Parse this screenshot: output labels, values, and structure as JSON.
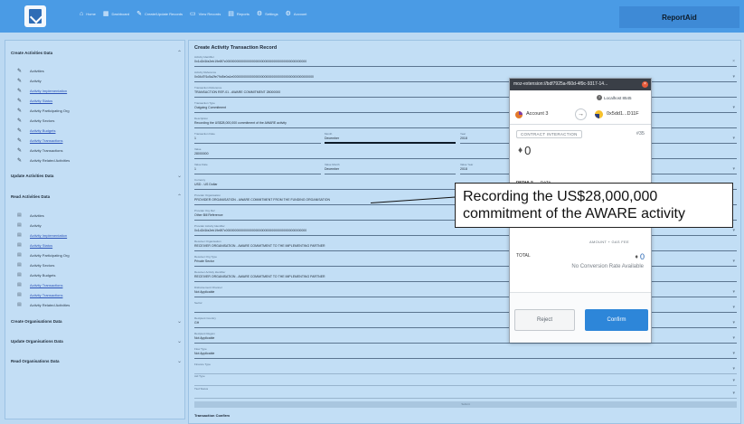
{
  "app": {
    "brand_button": "ReportAid",
    "nav": [
      {
        "icon": "⌂",
        "icon_name": "home-icon",
        "label": "Home"
      },
      {
        "icon": "▦",
        "icon_name": "dashboard-icon",
        "label": "Dashboard"
      },
      {
        "icon": "✎",
        "icon_name": "edit-icon",
        "label": "Create/Update Records"
      },
      {
        "icon": "▭",
        "icon_name": "view-icon",
        "label": "View Records"
      },
      {
        "icon": "▤",
        "icon_name": "reports-icon",
        "label": "Reports"
      },
      {
        "icon": "⚙",
        "icon_name": "gear-icon",
        "label": "Settings"
      },
      {
        "icon": "⚙",
        "icon_name": "account-icon",
        "label": "Account"
      }
    ]
  },
  "sidebar": {
    "create": {
      "title": "Create Activities Data",
      "items": [
        {
          "label": "Activities",
          "link": false
        },
        {
          "label": "Activity",
          "link": false
        },
        {
          "label": "Activity Implementation",
          "link": true
        },
        {
          "label": "Activity Status",
          "link": true
        },
        {
          "label": "Activity Participating Org",
          "link": false
        },
        {
          "label": "Activity Sectors",
          "link": false
        },
        {
          "label": "Activity Budgets",
          "link": true
        },
        {
          "label": "Activity Transactions",
          "link": true
        },
        {
          "label": "Activity Transactions",
          "link": false
        },
        {
          "label": "Activity Related Activities",
          "link": false
        }
      ]
    },
    "update": {
      "title": "Update Activities Data"
    },
    "read": {
      "title": "Read Activities Data",
      "items": [
        {
          "label": "Activities",
          "link": false
        },
        {
          "label": "Activity",
          "link": false
        },
        {
          "label": "Activity Implementation",
          "link": true
        },
        {
          "label": "Activity Status",
          "link": true
        },
        {
          "label": "Activity Participating Org",
          "link": false
        },
        {
          "label": "Activity Sectors",
          "link": false
        },
        {
          "label": "Activity Budgets",
          "link": false
        },
        {
          "label": "Activity Transactions",
          "link": true
        },
        {
          "label": "Activity Transactions",
          "link": true
        },
        {
          "label": "Activity Related Activities",
          "link": false
        }
      ]
    },
    "create_org": {
      "title": "Create Organisations Data"
    },
    "update_org": {
      "title": "Update Organisations Data"
    },
    "read_org": {
      "title": "Read Organisations Data"
    }
  },
  "form": {
    "title": "Create Activity Transaction Record",
    "fields": {
      "identifier": {
        "label": "Activity Identifier",
        "value": "0x1d2d1fa2eb19e8f7c0000000000000000000000000000000000000000000000"
      },
      "activity": {
        "label": "Activity Reference",
        "value": "0x04d7f1c5a2fe79d5e0a1e0000000000000000000000000000000000000000000000"
      },
      "ref": {
        "label": "Transaction Reference",
        "value": "TRANSACTION REF-01 - AWARE COMMITMENT 28000000"
      },
      "type": {
        "label": "Transaction Type",
        "value": "Outgoing Commitment"
      },
      "description": {
        "label": "Description",
        "value": "Recording the US$28,000,000 commitment of the AWARE activity"
      },
      "date": {
        "label": "Transaction Date",
        "value": "1"
      },
      "month": {
        "label": "Month",
        "value": "December"
      },
      "year": {
        "label": "Year",
        "value": "2018"
      },
      "value": {
        "label": "Value",
        "value": "28000000"
      },
      "valuedate": {
        "label": "Value Date",
        "value": "1"
      },
      "valuemonth": {
        "label": "Value Month",
        "value": "December"
      },
      "valueyear": {
        "label": "Value Year",
        "value": "2018"
      },
      "currency": {
        "label": "Currency",
        "value": "USD - US Dollar"
      },
      "provider_org": {
        "label": "Provider Organisation",
        "value": "PROVIDER ORGANISATION - AWARE COMMITMENT FROM THE FUNDING ORGANISATION"
      },
      "provider_ref": {
        "label": "Provider Org Ref",
        "value": "Other Bill Reference"
      },
      "provider_activity": {
        "label": "Provider Activity Identifier",
        "value": "0x1d2d1fa2eb19e8f7c0000000000000000000000000000000000000000000000"
      },
      "receiver_org": {
        "label": "Receiver Organisation",
        "value": "RECEIVER ORGANISATION - AWARE COMMITMENT TO THE IMPLEMENTING PARTNER"
      },
      "receiver_type": {
        "label": "Receiver Org Type",
        "value": "Private Sector"
      },
      "receiver_activity": {
        "label": "Receiver Activity Identifier",
        "value": "RECEIVER ORGANISATION - AWARE COMMITMENT TO THE IMPLEMENTING PARTNER"
      },
      "disbursement": {
        "label": "Disbursement Channel",
        "value": "Not Applicable"
      },
      "sector": {
        "label": "Sector",
        "value": ""
      },
      "recipient_country": {
        "label": "Recipient Country",
        "value": "GH"
      },
      "recipient_region": {
        "label": "Recipient Region",
        "value": "Not Applicable"
      },
      "flow_type": {
        "label": "Flow Type",
        "value": "Not Applicable"
      },
      "finance_type": {
        "label": "Finance Type",
        "value": ""
      },
      "aid_type": {
        "label": "Aid Type",
        "value": ""
      },
      "tied_status": {
        "label": "Tied Status",
        "value": ""
      },
      "tied_status2": {
        "label": "Tied Status",
        "value": ""
      }
    },
    "progress_label": "Submit",
    "tx_section": "Transaction Confirm"
  },
  "wallet": {
    "title": "moz-extension://bdf7925a-f60d-4f9c-9317-14...",
    "close": "×",
    "network": "Localhost 8545",
    "from": "Account 3",
    "arrow": "→",
    "to": "0x5dd1...D11F",
    "contract_badge": "CONTRACT INTERACTION",
    "contract_num": "#35",
    "amount": "0",
    "tabs": [
      "DETAILS",
      "DATA"
    ],
    "sub_label": "AMOUNT + GAS FEE",
    "total_label": "TOTAL",
    "total_value": "0",
    "no_rate": "No Conversion Rate Available",
    "reject": "Reject",
    "confirm": "Confirm"
  },
  "annotation": {
    "line1": "Recording the US$28,000,000",
    "line2": "commitment of the AWARE activity"
  },
  "colors": {
    "topbar": "#4a9be5",
    "background": "#bcd9f2",
    "confirm": "#2d86d9",
    "close": "#e65a3a"
  }
}
